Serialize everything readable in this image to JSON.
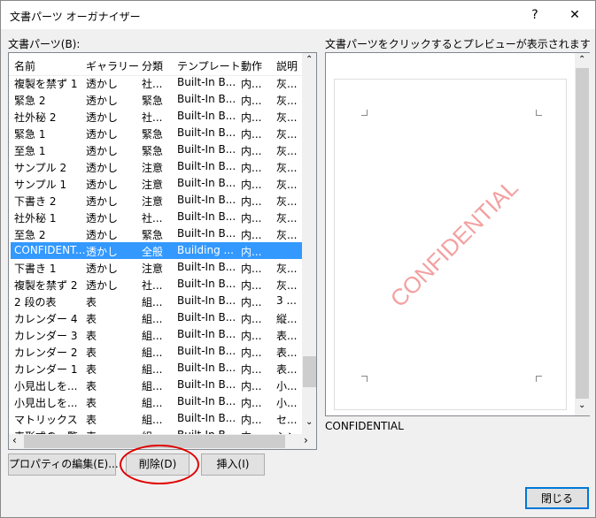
{
  "window": {
    "title": "文書パーツ オーガナイザー",
    "help": "?",
    "close": "✕"
  },
  "list": {
    "label": "文書パーツ(B):",
    "columns": [
      "名前",
      "ギャラリー",
      "分類",
      "テンプレート",
      "動作",
      "説明"
    ],
    "rows": [
      [
        "複製を禁ず 1",
        "透かし",
        "社...",
        "Built-In B...",
        "内...",
        "灰..."
      ],
      [
        "緊急 2",
        "透かし",
        "緊急",
        "Built-In B...",
        "内...",
        "灰..."
      ],
      [
        "社外秘 2",
        "透かし",
        "社...",
        "Built-In B...",
        "内...",
        "灰..."
      ],
      [
        "緊急 1",
        "透かし",
        "緊急",
        "Built-In B...",
        "内...",
        "灰..."
      ],
      [
        "至急 1",
        "透かし",
        "緊急",
        "Built-In B...",
        "内...",
        "灰..."
      ],
      [
        "サンプル 2",
        "透かし",
        "注意",
        "Built-In B...",
        "内...",
        "灰..."
      ],
      [
        "サンプル 1",
        "透かし",
        "注意",
        "Built-In B...",
        "内...",
        "灰..."
      ],
      [
        "下書き 2",
        "透かし",
        "注意",
        "Built-In B...",
        "内...",
        "灰..."
      ],
      [
        "社外秘 1",
        "透かし",
        "社...",
        "Built-In B...",
        "内...",
        "灰..."
      ],
      [
        "至急 2",
        "透かし",
        "緊急",
        "Built-In B...",
        "内...",
        "灰..."
      ],
      [
        "CONFIDENT...",
        "透かし",
        "全般",
        "Building ...",
        "内...",
        ""
      ],
      [
        "下書き 1",
        "透かし",
        "注意",
        "Built-In B...",
        "内...",
        "灰..."
      ],
      [
        "複製を禁ず 2",
        "透かし",
        "社...",
        "Built-In B...",
        "内...",
        "灰..."
      ],
      [
        "2 段の表",
        "表",
        "組...",
        "Built-In B...",
        "内...",
        "3 ..."
      ],
      [
        "カレンダー 4",
        "表",
        "組...",
        "Built-In B...",
        "内...",
        "縦..."
      ],
      [
        "カレンダー 3",
        "表",
        "組...",
        "Built-In B...",
        "内...",
        "表..."
      ],
      [
        "カレンダー 2",
        "表",
        "組...",
        "Built-In B...",
        "内...",
        "表..."
      ],
      [
        "カレンダー 1",
        "表",
        "組...",
        "Built-In B...",
        "内...",
        "表..."
      ],
      [
        "小見出しを...",
        "表",
        "組...",
        "Built-In B...",
        "内...",
        "小..."
      ],
      [
        "小見出しを...",
        "表",
        "組...",
        "Built-In B...",
        "内...",
        "小..."
      ],
      [
        "マトリックス",
        "表",
        "組...",
        "Built-In B...",
        "内...",
        "セ..."
      ],
      [
        "表形式の一覧",
        "表",
        "組...",
        "Built-In B...",
        "内...",
        "シン..."
      ]
    ],
    "selected_index": 10
  },
  "buttons": {
    "edit": "プロパティの編集(E)...",
    "delete": "削除(D)",
    "insert": "挿入(I)",
    "close": "閉じる"
  },
  "preview": {
    "label": "文書パーツをクリックするとプレビューが表示されます",
    "watermark": "CONFIDENTIAL",
    "name": "CONFIDENTIAL"
  },
  "colors": {
    "selection": "#3399ff",
    "watermark": "#f4a0a0",
    "annotation": "#e00000"
  }
}
